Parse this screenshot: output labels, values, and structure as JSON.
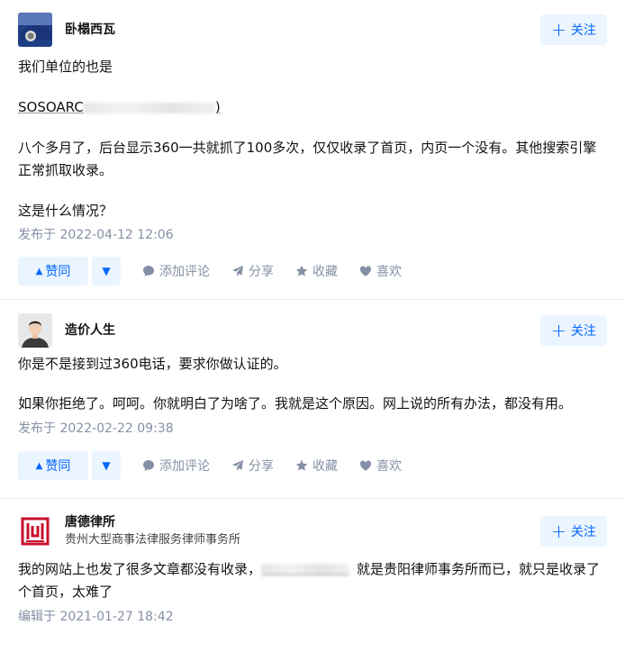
{
  "answers": [
    {
      "author": {
        "name": "卧榻西瓦",
        "subtitle": ""
      },
      "follow_label": "关注",
      "paragraphs": {
        "p1": "我们单位的也是",
        "p2_prefix": "SOSOARC",
        "p2_suffix": ")",
        "p3": "八个多月了，后台显示360一共就抓了100多次，仅仅收录了首页，内页一个没有。其他搜索引擎正常抓取收录。",
        "p4": "这是什么情况？"
      },
      "date": "发布于 2022-04-12 12:06",
      "actions": {
        "upvote": "赞同",
        "comment": "添加评论",
        "share": "分享",
        "collect": "收藏",
        "like": "喜欢"
      }
    },
    {
      "author": {
        "name": "造价人生",
        "subtitle": ""
      },
      "follow_label": "关注",
      "paragraphs": {
        "p1": "你是不是接到过360电话，要求你做认证的。",
        "p2": "如果你拒绝了。呵呵。你就明白了为啥了。我就是这个原因。网上说的所有办法，都没有用。"
      },
      "date": "发布于 2022-02-22 09:38",
      "actions": {
        "upvote": "赞同",
        "comment": "添加评论",
        "share": "分享",
        "collect": "收藏",
        "like": "喜欢"
      }
    },
    {
      "author": {
        "name": "唐德律所",
        "subtitle": "贵州大型商事法律服务律师事务所"
      },
      "follow_label": "关注",
      "paragraphs": {
        "p1_prefix": "我的网站上也发了很多文章都没有收录，",
        "p1_suffix": "就是贵阳律师事务所而已，就只是收录了个首页，太难了"
      },
      "date": "编辑于 2021-01-27 18:42"
    }
  ],
  "colors": {
    "accent": "#0066ff",
    "accent_bg": "#ebf5ff",
    "meta": "#8590a6",
    "logo_red": "#c8102e"
  }
}
